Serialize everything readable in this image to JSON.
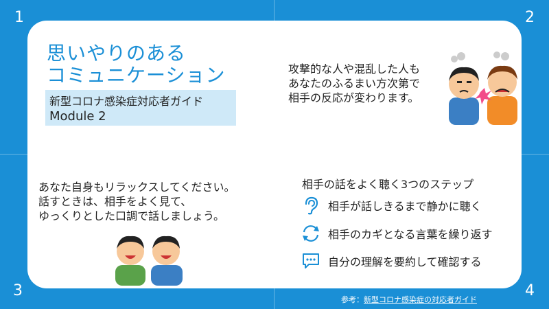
{
  "slide": {
    "corner_numbers": [
      "1",
      "2",
      "3",
      "4"
    ],
    "title_lines": [
      "思いやりのある",
      "コミュニケーション"
    ],
    "subtitle": {
      "line1": "新型コロナ感染症対応者ガイド",
      "line2": "Module 2"
    },
    "quadrant2_lines": [
      "攻撃的な人や混乱した人も",
      "あなたのふるまい方次第で",
      "相手の反応が変わります。"
    ],
    "quadrant3_lines": [
      "あなた自身もリラックスしてください。",
      "話すときは、相手をよく見て、",
      "ゆっくりとした口調で話しましょう。"
    ],
    "steps_title": "相手の話をよく聴く3つのステップ",
    "steps": [
      {
        "icon": "ear-icon",
        "label": "相手が話しきるまで静かに聴く"
      },
      {
        "icon": "repeat-arrows-icon",
        "label": "相手のカギとなる言葉を繰り返す"
      },
      {
        "icon": "speech-bubble-icon",
        "label": "自分の理解を要約して確認する"
      }
    ],
    "footer": {
      "prefix": "参考：",
      "link": "新型コロナ感染症の対応者ガイド"
    },
    "colors": {
      "accent": "#1a8fd6",
      "subtitle_bg": "#cfe9f8"
    }
  }
}
